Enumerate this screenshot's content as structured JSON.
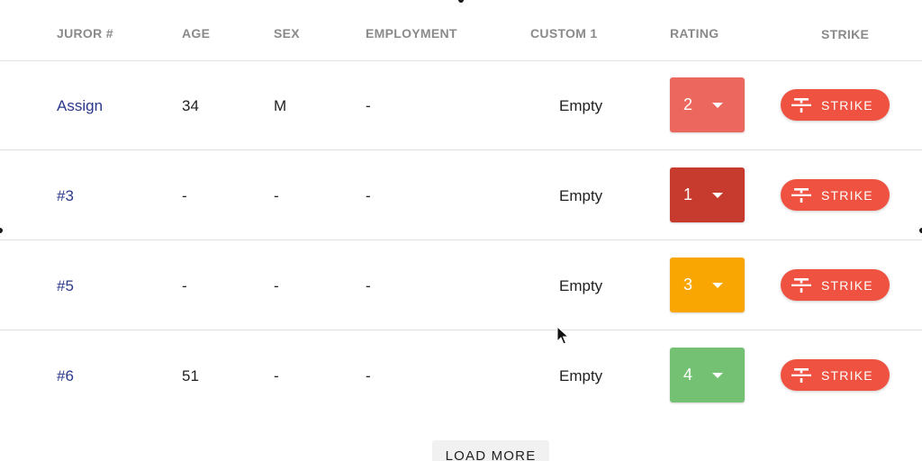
{
  "columns": {
    "juror": "JUROR #",
    "age": "AGE",
    "sex": "SEX",
    "employment": "EMPLOYMENT",
    "custom1": "CUSTOM 1",
    "rating": "RATING",
    "strike": "STRIKE"
  },
  "rows": [
    {
      "juror": "Assign",
      "age": "34",
      "sex": "M",
      "employment": "-",
      "custom1": "Empty",
      "rating": "2",
      "rating_color": "#ec675d",
      "strike_label": "STRIKE"
    },
    {
      "juror": "#3",
      "age": "-",
      "sex": "-",
      "employment": "-",
      "custom1": "Empty",
      "rating": "1",
      "rating_color": "#c73a2e",
      "strike_label": "STRIKE"
    },
    {
      "juror": "#5",
      "age": "-",
      "sex": "-",
      "employment": "-",
      "custom1": "Empty",
      "rating": "3",
      "rating_color": "#f9a502",
      "strike_label": "STRIKE"
    },
    {
      "juror": "#6",
      "age": "51",
      "sex": "-",
      "employment": "-",
      "custom1": "Empty",
      "rating": "4",
      "rating_color": "#75c174",
      "strike_label": "STRIKE"
    }
  ],
  "load_more_label": "LOAD MORE",
  "colors": {
    "strike_button": "#ef5240",
    "link": "#2b3a8c",
    "header_text": "#8a8a8a"
  },
  "icons": {
    "strike": "strikethrough-icon",
    "rating_dropdown": "caret-down-icon",
    "cursor": "mouse-pointer-icon"
  }
}
